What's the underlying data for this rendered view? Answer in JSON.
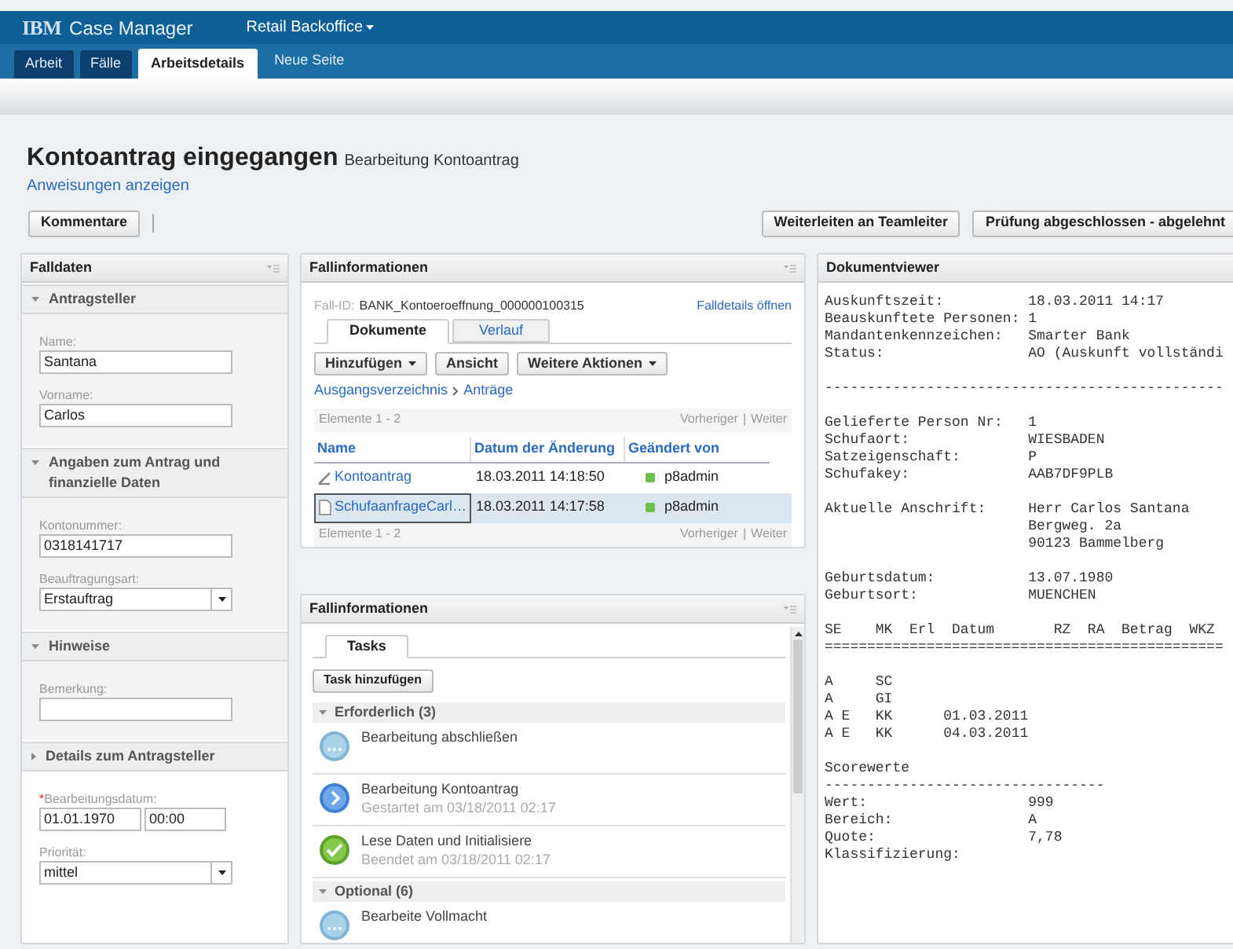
{
  "header": {
    "logo": "IBM",
    "product": "Case Manager",
    "solution": "Retail Backoffice"
  },
  "tabs": [
    {
      "label": "Arbeit",
      "selected": false
    },
    {
      "label": "Fälle",
      "selected": false
    },
    {
      "label": "Arbeitsdetails",
      "selected": true
    },
    {
      "label": "Neue Seite",
      "selected": false
    }
  ],
  "page": {
    "title": "Kontoantrag eingegangen",
    "subtitle": "Bearbeitung Kontoantrag",
    "link": "Anweisungen anzeigen",
    "left_button": "Kommentare",
    "right_buttons": [
      "Weiterleiten an Teamleiter",
      "Prüfung abgeschlossen - abgelehnt"
    ]
  },
  "falldaten": {
    "title": "Falldaten",
    "sections": [
      {
        "title": "Antragsteller",
        "expanded": true,
        "fields": [
          {
            "label": "Name:",
            "value": "Santana",
            "kind": "text"
          },
          {
            "label": "Vorname:",
            "value": "Carlos",
            "kind": "text"
          }
        ]
      },
      {
        "title": "Angaben zum Antrag und finanzielle Daten",
        "expanded": true,
        "fields": [
          {
            "label": "Kontonummer:",
            "value": "0318141717",
            "kind": "text"
          },
          {
            "label": "Beauftragungsart:",
            "value": "Erstauftrag",
            "kind": "select"
          }
        ]
      },
      {
        "title": "Hinweise",
        "expanded": true,
        "fields": [
          {
            "label": "Bemerkung:",
            "kind": "text"
          }
        ]
      },
      {
        "title": "Details zum Antragsteller",
        "expanded": false,
        "fields": [
          {
            "required_mark": "*",
            "label": "Bearbeitungsdatum:",
            "value": "01.01.1970",
            "time": "00:00",
            "kind": "datetime"
          },
          {
            "label": "Priorität:",
            "value": "mittel",
            "kind": "select"
          }
        ]
      }
    ]
  },
  "documents": {
    "title": "Fallinformationen",
    "case_id_label": "Fall-ID:",
    "case_id": "BANK_Kontoeroeffnung_000000100315",
    "open_link": "Falldetails öffnen",
    "tabs": [
      {
        "label": "Dokumente",
        "selected": true
      },
      {
        "label": "Verlauf",
        "selected": false
      }
    ],
    "buttons": [
      {
        "label": "Hinzufügen",
        "dropdown": true
      },
      {
        "label": "Ansicht",
        "dropdown": false
      },
      {
        "label": "Weitere Aktionen",
        "dropdown": true
      }
    ],
    "breadcrumb": [
      "Ausgangsverzeichnis",
      "Anträge"
    ],
    "count": "Elemente 1 - 2",
    "prev": "Vorheriger",
    "separator": "|",
    "next": "Weiter",
    "columns": [
      "Name",
      "Datum der Änderung",
      "Geändert von"
    ],
    "rows": [
      {
        "name": "Kontoantrag",
        "kind": "form",
        "date": "18.03.2011 14:18:50",
        "user": "p8admin",
        "color": "#6cc04a",
        "selected": false
      },
      {
        "name": "SchufaanfrageCarl…",
        "kind": "document",
        "date": "18.03.2011 14:17:58",
        "user": "p8admin",
        "color": "#6cc04a",
        "selected": true
      }
    ],
    "footer_count": "Elemente 1 - 2",
    "footer_prev": "Vorheriger",
    "footer_separator": "|",
    "footer_next": "Weiter"
  },
  "tasks": {
    "title": "Fallinformationen",
    "tab": "Tasks",
    "add_button": "Task hinzufügen",
    "groups": [
      {
        "title": "Erforderlich (3)",
        "expanded": true,
        "items": [
          {
            "title": "Bearbeitung abschließen",
            "kind": "waiting"
          },
          {
            "title": "Bearbeitung Kontoantrag",
            "info": "Gestartet am 03/18/2011 02:17",
            "kind": "started"
          },
          {
            "title": "Lese Daten und Initialisiere",
            "info": "Beendet am 03/18/2011 02:17",
            "kind": "done"
          }
        ]
      },
      {
        "title": "Optional (6)",
        "expanded": true,
        "items": [
          {
            "title": "Bearbeite Vollmacht",
            "kind": "waiting"
          }
        ]
      }
    ]
  },
  "viewer": {
    "title": "Dokumentviewer",
    "blocks": [
      [
        "Auskunftszeit:          18.03.2011 14:17",
        "Beauskunftete Personen: 1",
        "Mandantenkennzeichen:   Smarter Bank",
        "Status:                 AO (Auskunft vollständi"
      ],
      [
        "-----------------------------------------------"
      ],
      [
        "Gelieferte Person Nr:   1",
        "Schufaort:              WIESBADEN",
        "Satzeigenschaft:        P",
        "Schufakey:              AAB7DF9PLB"
      ],
      [
        "Aktuelle Anschrift:     Herr Carlos Santana",
        "                        Bergweg. 2a",
        "                        90123 Bammelberg"
      ],
      [
        "Geburtsdatum:           13.07.1980",
        "Geburtsort:             MUENCHEN"
      ],
      [
        "SE    MK  Erl  Datum       RZ  RA  Betrag  WKZ",
        "==============================================="
      ],
      [
        "A     SC",
        "A     GI",
        "A E   KK      01.03.2011",
        "A E   KK      04.03.2011"
      ],
      [
        "Scorewerte",
        "---------------------------------",
        "Wert:                   999",
        "Bereich:                A",
        "Quote:                  7,78",
        "Klassifizierung:"
      ]
    ]
  }
}
